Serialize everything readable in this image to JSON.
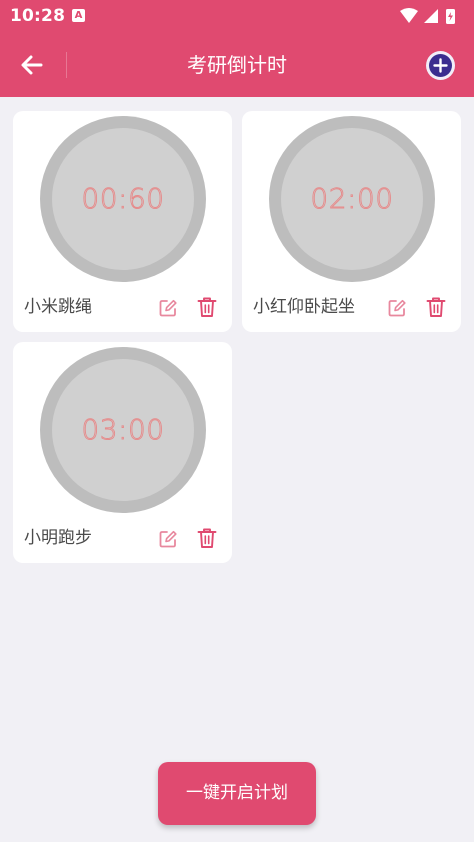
{
  "status_bar": {
    "time": "10:28",
    "notification_badge": "A"
  },
  "app_bar": {
    "title": "考研倒计时",
    "back_icon": "arrow-left-icon",
    "add_icon": "plus-circle-icon"
  },
  "timers": [
    {
      "name": "小米跳绳",
      "time": "00:60"
    },
    {
      "name": "小红仰卧起坐",
      "time": "02:00"
    },
    {
      "name": "小明跑步",
      "time": "03:00"
    }
  ],
  "footer": {
    "start_all_label": "一键开启计划"
  },
  "colors": {
    "primary": "#e04a70",
    "background": "#f1f0f5",
    "dial_ring": "#bdbdbd",
    "dial_face": "#d0d0d0",
    "dial_text": "#e68a8a",
    "add_button": "#3b2d8f"
  }
}
